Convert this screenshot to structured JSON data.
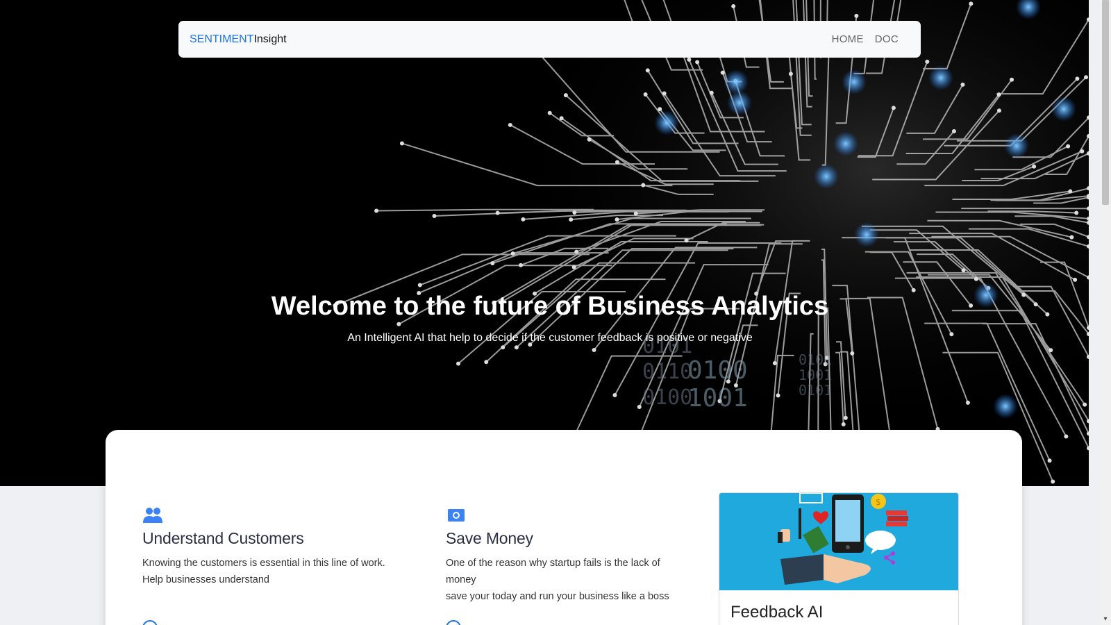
{
  "navbar": {
    "brand_part1": "SENTIMENT",
    "brand_part2": "Insight",
    "links": [
      "HOME",
      "DOC"
    ]
  },
  "hero": {
    "title": "Welcome to the future of Business Analytics",
    "subtitle": "An Intelligent AI that help to decide if the customer feedback is positive or negative"
  },
  "features": [
    {
      "icon": "users-icon",
      "title": "Understand Customers",
      "line1": "Knowing the customers is essential in this line of work.",
      "line2": "Help businesses understand"
    },
    {
      "icon": "money-icon",
      "title": "Save Money",
      "line1": "One of the reason why startup fails is the lack of money",
      "line2": "save your today and run your business like a boss"
    }
  ],
  "feedback_card": {
    "title": "Feedback AI"
  },
  "colors": {
    "accent": "#1a73e8",
    "hero_bg": "#000000",
    "card_image_bg": "#1fa9dd"
  }
}
